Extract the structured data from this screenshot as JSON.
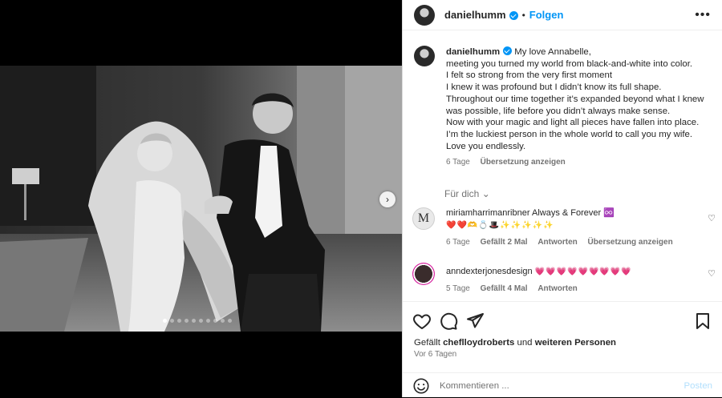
{
  "header": {
    "username": "danielhumm",
    "separator": "•",
    "follow_label": "Folgen",
    "more": "•••"
  },
  "caption": {
    "username": "danielhumm",
    "lines": [
      "My love Annabelle,",
      "meeting you turned my world from black-and-white into color.",
      "I felt so strong from the very first moment",
      "I knew it was profound but I didn’t know its full shape.",
      "Throughout our time together it’s expanded beyond what I knew",
      "was possible, life before you didn’t always make sense.",
      "Now with your magic and light all pieces have fallen into place.",
      "I’m the luckiest person in the whole world to call you my wife.",
      "Love you endlessly."
    ],
    "age": "6 Tage",
    "translate": "Übersetzung anzeigen"
  },
  "for_you": "Für dich",
  "comments": [
    {
      "username": "miriamharrimanribner",
      "text": "Always & Forever ♾️",
      "emoji_line": "❤️❤️🫶💍🎩✨✨✨✨✨",
      "age": "6 Tage",
      "likes": "Gefällt 2 Mal",
      "reply": "Antworten",
      "translate": "Übersetzung anzeigen"
    },
    {
      "username": "anndexterjonesdesign",
      "text": "💗💗💗💗💗💗💗💗💗",
      "age": "5 Tage",
      "likes": "Gefällt 4 Mal",
      "reply": "Antworten"
    }
  ],
  "liked_by": {
    "prefix": "Gefällt",
    "user": "cheflloydroberts",
    "middle": "und",
    "others": "weiteren Personen"
  },
  "timestamp": "Vor 6 Tagen",
  "composer": {
    "placeholder": "Kommentieren ...",
    "post_label": "Posten"
  },
  "carousel": {
    "total": 10,
    "active_index": 0,
    "next_icon": "chevron-right-icon"
  },
  "colors": {
    "accent": "#0095f6",
    "muted": "#737373",
    "post_disabled": "#b2dffc"
  }
}
